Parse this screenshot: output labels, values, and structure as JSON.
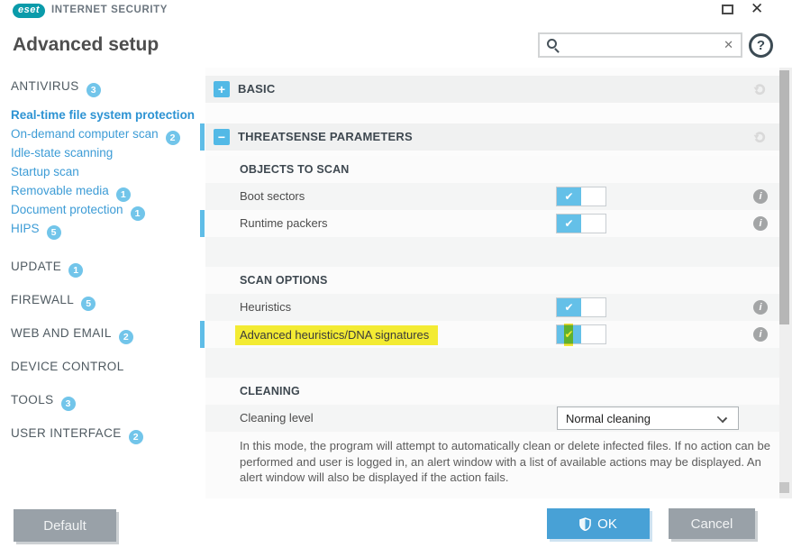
{
  "window": {
    "product_logo": "eset",
    "product_name": "INTERNET SECURITY",
    "title": "Advanced setup"
  },
  "titlebar": {
    "close_icon": "✕"
  },
  "search": {
    "value": "",
    "placeholder": "",
    "clear_icon": "✕"
  },
  "help": {
    "icon": "?"
  },
  "sidebar": {
    "items": [
      {
        "label": "ANTIVIRUS",
        "badge": "3"
      },
      {
        "label": "Real-time file system protection",
        "selected": true
      },
      {
        "label": "On-demand computer scan",
        "badge": "2"
      },
      {
        "label": "Idle-state scanning"
      },
      {
        "label": "Startup scan"
      },
      {
        "label": "Removable media",
        "badge": "1"
      },
      {
        "label": "Document protection",
        "badge": "1"
      },
      {
        "label": "HIPS",
        "badge": "5"
      },
      {
        "label": "UPDATE",
        "badge": "1"
      },
      {
        "label": "FIREWALL",
        "badge": "5"
      },
      {
        "label": "WEB AND EMAIL",
        "badge": "2"
      },
      {
        "label": "DEVICE CONTROL"
      },
      {
        "label": "TOOLS",
        "badge": "3"
      },
      {
        "label": "USER INTERFACE",
        "badge": "2"
      }
    ]
  },
  "content": {
    "headers": [
      {
        "icon": "+",
        "label": "BASIC",
        "expanded": false
      },
      {
        "icon": "−",
        "label": "THREATSENSE PARAMETERS",
        "expanded": true,
        "modified": true
      }
    ],
    "icons": {
      "check": "✔",
      "info": "i"
    },
    "sections": [
      {
        "title": "OBJECTS TO SCAN",
        "rows": [
          {
            "label": "Boot sectors",
            "toggle": "on"
          },
          {
            "label": "Runtime packers",
            "toggle": "on",
            "modified": true
          }
        ]
      },
      {
        "title": "SCAN OPTIONS",
        "rows": [
          {
            "label": "Heuristics",
            "toggle": "on"
          },
          {
            "label": "Advanced heuristics/DNA signatures",
            "toggle": "on",
            "modified": true,
            "highlighted": true
          }
        ]
      },
      {
        "title": "CLEANING",
        "rows": [
          {
            "label": "Cleaning level",
            "control": "dropdown",
            "value": "Normal cleaning"
          }
        ],
        "description": "In this mode, the program will attempt to automatically clean or delete infected files. If no action can be performed and user is logged in, an alert window with a list of available actions may be displayed. An alert window will also be displayed if the action fails."
      }
    ]
  },
  "footer": {
    "default_label": "Default",
    "ok_label": "OK",
    "cancel_label": "Cancel"
  },
  "colors": {
    "brand_teal": "#0a9baa",
    "accent_blue": "#52b9e6",
    "link_blue": "#3d9cd6",
    "ok_blue": "#48a1d6",
    "button_gray": "#99a1a8",
    "highlight_yellow": "#f3eb33",
    "modified_indicator_blue": "#5fbde7"
  }
}
